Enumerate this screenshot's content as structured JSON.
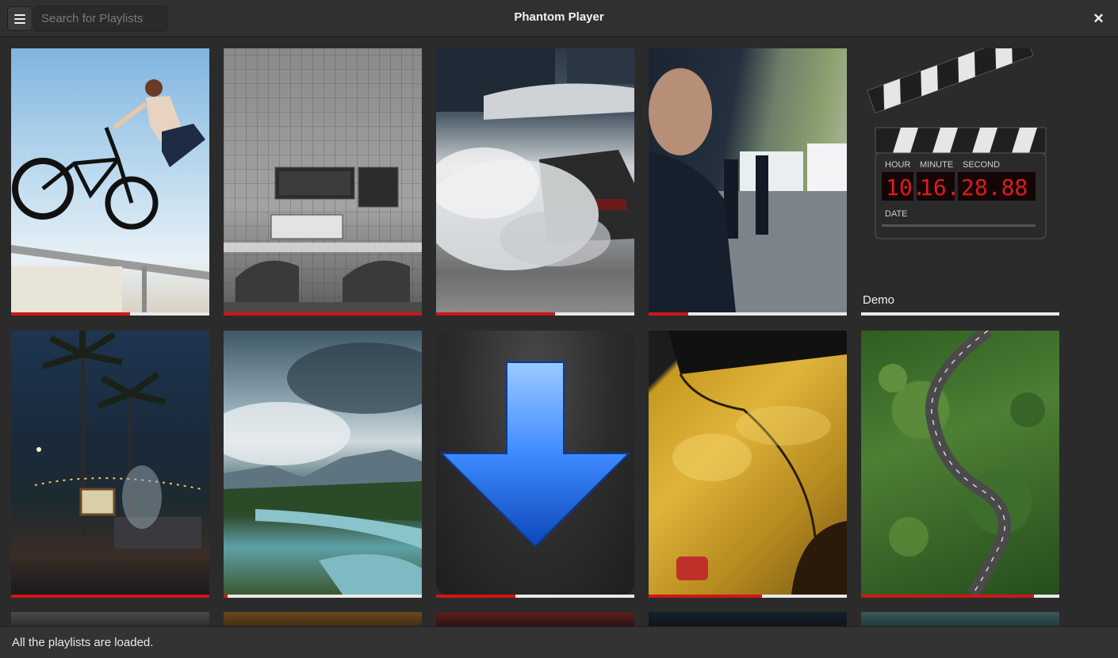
{
  "header": {
    "title": "Phantom Player",
    "search_placeholder": "Search for Playlists",
    "search_value": ""
  },
  "playlists": [
    {
      "thumbnail": "bmx-rider",
      "progress": 0.6
    },
    {
      "thumbnail": "circuit-board-workspace",
      "progress": 1.0
    },
    {
      "thumbnail": "car-burnout-smoke",
      "progress": 0.6
    },
    {
      "thumbnail": "police-officer-street",
      "progress": 0.2
    },
    {
      "thumbnail": "clapperboard-clock-icon",
      "label": "Demo",
      "clock": {
        "hour_label": "HOUR",
        "minute_label": "MINUTE",
        "second_label": "SECOND",
        "date_label": "DATE",
        "hour": "10.",
        "minute": "16.",
        "second": "28.88"
      },
      "progress": 0.0
    },
    {
      "thumbnail": "palm-trees-night-cinema",
      "progress": 1.0
    },
    {
      "thumbnail": "lake-mountains-clouds",
      "progress": 0.02
    },
    {
      "thumbnail": "download-arrow-icon",
      "progress": 0.4
    },
    {
      "thumbnail": "yellow-car-closeup",
      "progress": 0.57
    },
    {
      "thumbnail": "forest-winding-road",
      "progress": 0.87
    },
    {
      "thumbnail": "partial-thumbnail"
    },
    {
      "thumbnail": "partial-thumbnail"
    },
    {
      "thumbnail": "partial-thumbnail"
    },
    {
      "thumbnail": "partial-thumbnail"
    },
    {
      "thumbnail": "partial-thumbnail"
    }
  ],
  "status": {
    "text": "All the playlists are loaded."
  },
  "colors": {
    "progress_fill": "#d01616",
    "progress_track": "#e9e9e9",
    "background": "#2b2b2b"
  },
  "icons": {
    "menu": "hamburger-menu-icon",
    "close": "close-icon"
  }
}
